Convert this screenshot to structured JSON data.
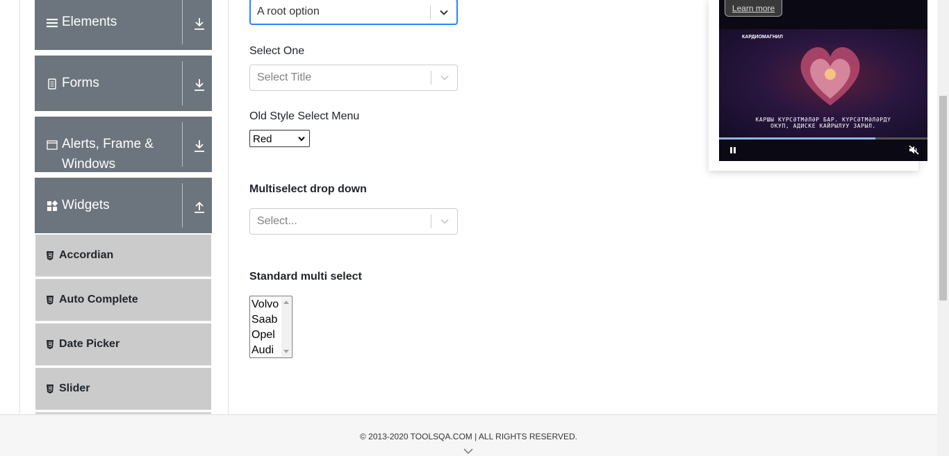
{
  "sidebar": {
    "groups": [
      {
        "label": "Elements",
        "icon": "hamburger-icon",
        "arrow": "download-arrow-icon"
      },
      {
        "label": "Forms",
        "icon": "document-icon",
        "arrow": "download-arrow-icon"
      },
      {
        "label_line1": "Alerts, Frame &",
        "label_line2": "Windows",
        "icon": "window-icon",
        "arrow": "download-arrow-icon"
      },
      {
        "label": "Widgets",
        "icon": "widgets-grid-icon",
        "arrow": "upload-arrow-icon"
      }
    ],
    "widget_items": [
      {
        "label": "Accordian",
        "icon": "html5-icon"
      },
      {
        "label": "Auto Complete",
        "icon": "html5-icon"
      },
      {
        "label": "Date Picker",
        "icon": "html5-icon"
      },
      {
        "label": "Slider",
        "icon": "html5-icon"
      }
    ]
  },
  "form": {
    "select_value": {
      "value": "A root option"
    },
    "select_one": {
      "label": "Select One",
      "placeholder": "Select Title"
    },
    "old_style": {
      "label": "Old Style Select Menu",
      "value": "Red"
    },
    "multiselect": {
      "label": "Multiselect drop down",
      "placeholder": "Select..."
    },
    "standard_multi": {
      "label": "Standard multi select",
      "options": [
        "Volvo",
        "Saab",
        "Opel",
        "Audi"
      ]
    }
  },
  "ad": {
    "learn_more": "Learn more",
    "brand": "КАРДИОМАГНИЛ",
    "caption_line1": "КАРШЫ КҮРСӘТМӘЛӘР БАР. КҮРСӘТМӘЛӘРДҮ",
    "caption_line2": "ОКУП, АДИСКЕ КАЙРЫЛУУ ЗАРЫЛ.",
    "progress": 0.75,
    "play_state": "pause-icon",
    "sound": "muted-speaker-icon"
  },
  "footer": {
    "copyright": "© 2013-2020 TOOLSQA.COM | ALL RIGHTS RESERVED."
  },
  "colors": {
    "group_bg": "#6c757d",
    "item_bg": "#cbcbcb",
    "focus": "#2684ff"
  }
}
